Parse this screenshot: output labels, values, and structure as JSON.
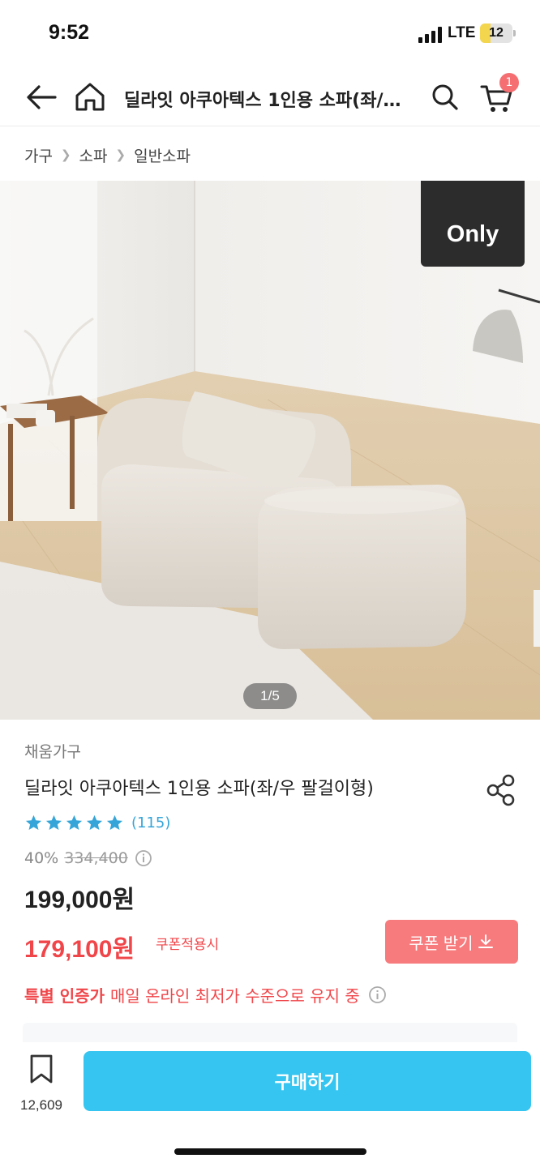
{
  "status_bar": {
    "time": "9:52",
    "network": "LTE",
    "battery": "12",
    "battery_level": 0.12
  },
  "header": {
    "title": "딜라잇 아쿠아텍스 1인용 소파(좌/우 팔걸이형)",
    "cart_count": "1",
    "icons": [
      "back-arrow-icon",
      "home-icon",
      "search-icon",
      "cart-icon"
    ]
  },
  "breadcrumb": [
    "가구",
    "소파",
    "일반소파"
  ],
  "image": {
    "badge": "Only",
    "counter": "1/5"
  },
  "product": {
    "brand": "채움가구",
    "name": "딜라잇 아쿠아텍스 1인용 소파(좌/우 팔걸이형)",
    "rating_stars": 5,
    "review_count": "(115)",
    "discount": "40%",
    "original_price": "334,400",
    "price": "199,000원",
    "coupon_price": "179,100원",
    "coupon_note": "쿠폰적용시",
    "coupon_button": "쿠폰 받기",
    "promo_strong": "특별 인증가",
    "promo_text": "매일 온라인 최저가 수준으로 유지 중"
  },
  "bottom_bar": {
    "bookmark_count": "12,609",
    "buy_label": "구매하기"
  },
  "colors": {
    "accent": "#35c5f0",
    "sale_red": "#f0464a",
    "coupon_button": "#f77b7d",
    "rating_star": "#35a5d9"
  }
}
